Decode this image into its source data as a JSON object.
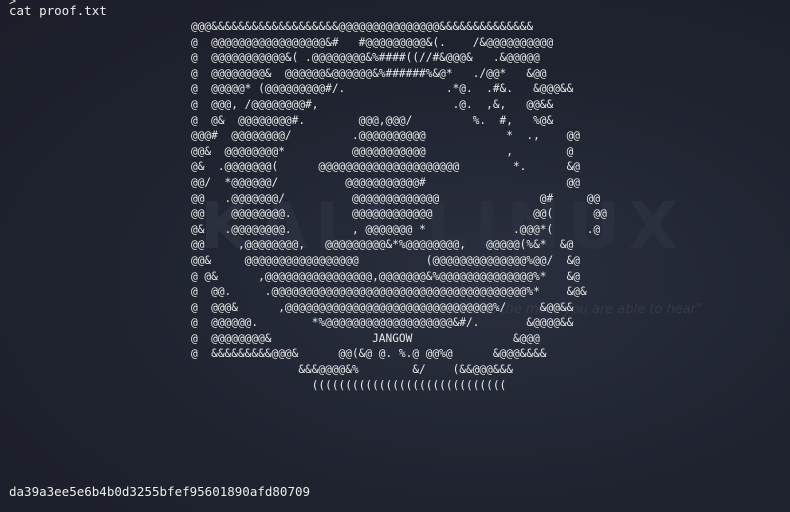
{
  "terminal": {
    "previous_output": ">",
    "command": "cat proof.txt",
    "ascii_art": [
      "@@@&&&&&&&&&&&&&&&&&&&@@@@@@@@@@@@@@@&&&&&&&&&&&&&&",
      "@  @@@@@@@@@@@@@@@@@&#   #@@@@@@@@@&(.    /&@@@@@@@@@@",
      "@  @@@@@@@@@@@&( .@@@@@@@@&%####((//#&@@@&   .&@@@@@",
      "@  @@@@@@@@&  @@@@@@&@@@@@@&%######%&@*   ./@@*   &@@",
      "@  @@@@@* (@@@@@@@@@#/.               .*@.  .#&.   &@@@&&",
      "@  @@@, /@@@@@@@@#,                    .@.  ,&,   @@&&",
      "@  @&  @@@@@@@@#.        @@@,@@@/         %.  #,   %@&",
      "@@@#  @@@@@@@@/         .@@@@@@@@@@            *  .,    @@",
      "@@&  @@@@@@@@*          @@@@@@@@@@@            ,        @",
      "@&  .@@@@@@@(      @@@@@@@@@@@@@@@@@@@@@        *.      &@",
      "@@/  *@@@@@@/          @@@@@@@@@@@#                     @@",
      "@@   .@@@@@@@/          @@@@@@@@@@@@@               @#     @@",
      "@@    @@@@@@@@.         @@@@@@@@@@@@               @@(      @@",
      "@&   .@@@@@@@@.         , @@@@@@@ *             .@@@*(     .@",
      "@@     ,@@@@@@@@,   @@@@@@@@@&*%@@@@@@@@,   @@@@@(%&*  &@",
      "@@&     @@@@@@@@@@@@@@@@@          (@@@@@@@@@@@@@@%@@/  &@",
      "@ @&      ,@@@@@@@@@@@@@@@@,@@@@@@@&%@@@@@@@@@@@@@@%*   &@",
      "@  @@.     .@@@@@@@@@@@@@@@@@@@@@@@@@@@@@@@@@@@@@@%*    &@&",
      "@  @@@&      ,@@@@@@@@@@@@@@@@@@@@@@@@@@@@@@@%/     &@@&&",
      "@  @@@@@@.        *%@@@@@@@@@@@@@@@@@@@&#/.       &@@@@&&",
      "@  @@@@@@@@&               JANGOW               &@@@",
      "@  &&&&&&&&&@@@&      @@(&@ @. %.@ @@%@      &@@@&&&&",
      "                &&&@@@@&%        &/    (&&@@@&&&",
      "                  ((((((((((((((((((((((((((((("
    ],
    "proof_hash": "da39a3ee5e6b4b0d3255bfef95601890afd80709"
  },
  "background": {
    "watermark_text": "KALI LINUX",
    "watermark_tagline": "\"the quieter you become, the more you are able to hear\"",
    "colors": {
      "background": "#1f2330",
      "text": "#e8e8e8",
      "watermark": "#2b3040"
    }
  }
}
